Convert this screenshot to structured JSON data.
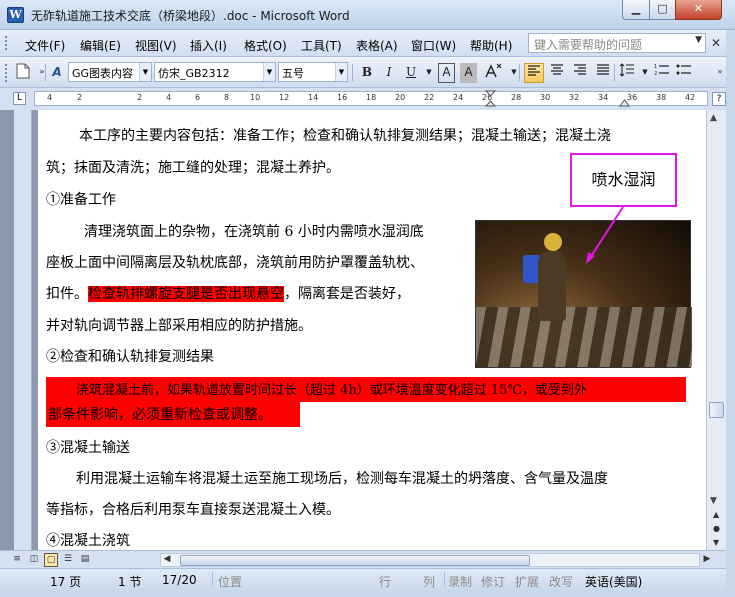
{
  "window": {
    "icon_label": "W",
    "title": "无砟轨道施工技术交底（桥梁地段）.doc - Microsoft Word",
    "minimize": "▁",
    "maximize": "□",
    "close": "✕"
  },
  "menu": {
    "items": [
      "文件(F)",
      "编辑(E)",
      "视图(V)",
      "插入(I)",
      "格式(O)",
      "工具(T)",
      "表格(A)",
      "窗口(W)",
      "帮助(H)"
    ],
    "help_search_placeholder": "键入需要帮助的问题",
    "doc_close": "✕"
  },
  "toolbar": {
    "style_value": "GG图表内容",
    "font_value": "仿宋_GB2312",
    "size_value": "五号",
    "bold": "B",
    "italic": "I",
    "underline": "U",
    "font_color": "A",
    "char_border": "A",
    "char_shading": "A",
    "new_doc_icon": "new-document-icon",
    "styles_icon": "styles-icon"
  },
  "ruler": {
    "corner": "L",
    "numbers": [
      "4",
      "2",
      "2",
      "4",
      "6",
      "8",
      "10",
      "12",
      "14",
      "16",
      "18",
      "20",
      "22",
      "24",
      "26",
      "28",
      "30",
      "32",
      "34",
      "36",
      "38",
      "42"
    ],
    "help_icon": "?"
  },
  "document": {
    "line1": "本工序的主要内容包括：准备工作；检查和确认轨排复测结果；混凝土输送；混凝土浇",
    "line2": "筑；抹面及清洗；施工缝的处理；混凝土养护。",
    "heading1": "①准备工作",
    "p1_l1": "清理浇筑面上的杂物，在浇筑前 6 小时内需喷水湿润底",
    "p1_l2": "座板上面中间隔离层及轨枕底部，浇筑前用防护罩覆盖轨枕、",
    "p1_l3_a": "扣件。",
    "p1_l3_hl": "检查轨排螺旋支腿是否出现悬空",
    "p1_l3_b": "，隔离套是否装好，",
    "p1_l4": "并对轨向调节器上部采用相应的防护措施。",
    "heading2": "②检查和确认轨排复测结果",
    "p2_l1": "浇筑混凝土前，如果轨道放置时间过长（超过 4h）或环境温度变化超过 15℃，或受到外",
    "p2_l2": "部条件影响，必须重新检查或调整。",
    "heading3": "③混凝土输送",
    "p3_l1": "利用混凝土运输车将混凝土运至施工现场后，检测每车混凝土的坍落度、含气量及温度",
    "p3_l2": "等指标，合格后利用泵车直接泵送混凝土入模。",
    "heading4": "④混凝土浇筑",
    "callout": "喷水湿润"
  },
  "status": {
    "page": "17 页",
    "section": "1 节",
    "page_of": "17/20",
    "position": "位置",
    "line": "行",
    "column": "列",
    "record": "录制",
    "revise": "修订",
    "extend": "扩展",
    "overwrite": "改写",
    "language": "英语(美国)"
  },
  "colors": {
    "highlight": "#ff0000",
    "callout_border": "#e515e5",
    "chrome": "#c9d7ea"
  }
}
